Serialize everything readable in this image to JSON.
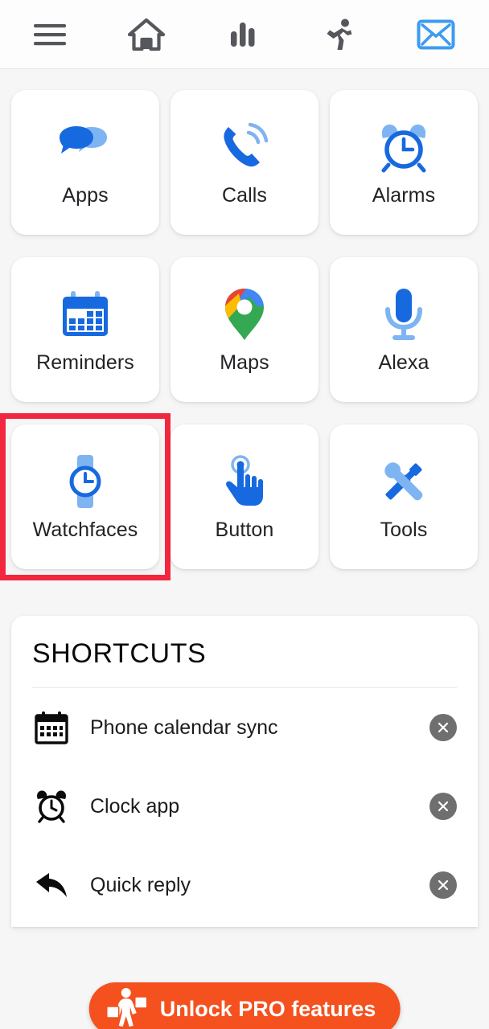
{
  "topbar": {
    "items": [
      {
        "name": "menu-icon",
        "label": "Menu",
        "state": "inactive"
      },
      {
        "name": "home-icon",
        "label": "Home",
        "state": "inactive"
      },
      {
        "name": "stats-icon",
        "label": "Stats",
        "state": "inactive"
      },
      {
        "name": "activity-icon",
        "label": "Activity",
        "state": "inactive"
      },
      {
        "name": "messages-icon",
        "label": "Messages",
        "state": "active"
      }
    ],
    "active_color": "#3d9bf0",
    "inactive_color": "#55575c"
  },
  "grid": {
    "tiles": [
      {
        "label": "Apps",
        "icon": "chat-bubbles-icon",
        "selected": false
      },
      {
        "label": "Calls",
        "icon": "phone-call-icon",
        "selected": false
      },
      {
        "label": "Alarms",
        "icon": "alarm-clock-icon",
        "selected": false
      },
      {
        "label": "Reminders",
        "icon": "calendar-icon",
        "selected": false
      },
      {
        "label": "Maps",
        "icon": "map-pin-icon",
        "selected": false
      },
      {
        "label": "Alexa",
        "icon": "microphone-icon",
        "selected": false
      },
      {
        "label": "Watchfaces",
        "icon": "smartwatch-icon",
        "selected": true
      },
      {
        "label": "Button",
        "icon": "tap-hand-icon",
        "selected": false
      },
      {
        "label": "Tools",
        "icon": "tools-icon",
        "selected": false
      }
    ],
    "selection_color": "#f2273f",
    "accent_color": "#1769e0",
    "accent_light_color": "#7fb4f2"
  },
  "shortcuts": {
    "title": "SHORTCUTS",
    "rows": [
      {
        "label": "Phone calendar sync",
        "icon": "calendar-icon",
        "remove": "×"
      },
      {
        "label": "Clock app",
        "icon": "alarm-clock-icon",
        "remove": "×"
      },
      {
        "label": "Quick reply",
        "icon": "reply-arrow-icon",
        "remove": "×"
      }
    ]
  },
  "pro_banner": {
    "label": "Unlock PRO features",
    "icon": "shopper-icon",
    "color": "#f4511e"
  }
}
